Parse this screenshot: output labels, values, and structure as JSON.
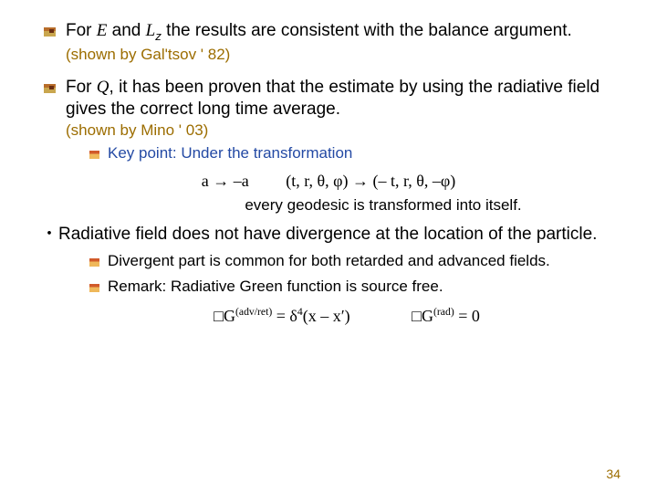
{
  "bullets": {
    "b1": {
      "pre": " For ",
      "E": "E",
      "mid1": " and ",
      "L": "L",
      "sub": "z",
      "rest": " the results are consistent with the balance argument. ",
      "cite": "(shown by Gal'tsov ' 82)"
    },
    "b2": {
      "pre": "For ",
      "Q": "Q",
      "rest": ", it has been proven that the estimate by  using the radiative field gives the correct long time average.",
      "cite": "(shown by Mino ' 03)"
    },
    "key": {
      "label": "Key point: Under the transformation",
      "eq1": "a → –a",
      "eq2": "(t, r, θ, φ) → (– t, r, θ, –φ)",
      "conc": "every geodesic is transformed into itself."
    },
    "b3": "Radiative field does not have divergence at the location of the particle.",
    "div": "Divergent part is common for both retarded and advanced fields.",
    "rem": "Remark: Radiative Green function is source free.",
    "eqG": {
      "lhs1": "□G",
      "sup1": "(adv/ret)",
      "mid": " = δ",
      "sup2": "4",
      "arg": "(x – x′)",
      "lhs2": "□G",
      "sup3": "(rad)",
      "rhs2": " = 0"
    }
  },
  "page": "34"
}
